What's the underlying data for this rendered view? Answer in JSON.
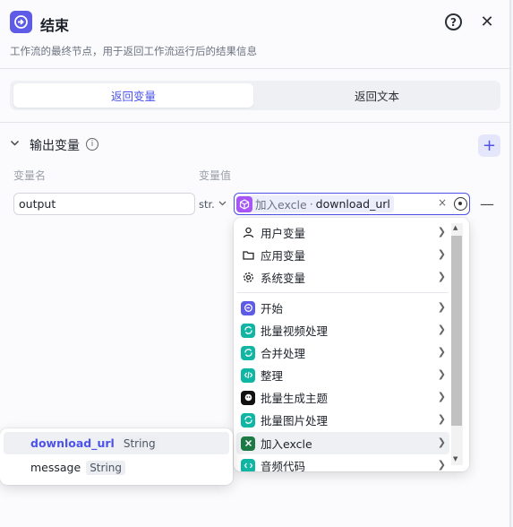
{
  "header": {
    "title": "结束",
    "help_icon": "help-circle-icon",
    "close_icon": "close-icon",
    "description": "工作流的最终节点，用于返回工作流运行后的结果信息"
  },
  "tabs": [
    {
      "label": "返回变量",
      "active": true
    },
    {
      "label": "返回文本",
      "active": false
    }
  ],
  "output_section": {
    "title": "输出变量",
    "col_name": "变量名",
    "col_value": "变量值",
    "rows": [
      {
        "name": "output",
        "type": "str.",
        "value_node": "加入excle",
        "value_sep": "·",
        "value_var": "download_url",
        "clear_glyph": "×",
        "remove_glyph": "—"
      }
    ]
  },
  "dropdown": {
    "groups": [
      {
        "label": "用户变量",
        "icon": "user-icon"
      },
      {
        "label": "应用变量",
        "icon": "folder-icon"
      },
      {
        "label": "系统变量",
        "icon": "gear-icon"
      }
    ],
    "nodes": [
      {
        "label": "开始",
        "icon": "start-icon",
        "color": "#5e5ce6"
      },
      {
        "label": "批量视频处理",
        "icon": "loop-icon",
        "color": "#10b5a3"
      },
      {
        "label": "合并处理",
        "icon": "loop-icon",
        "color": "#10b5a3"
      },
      {
        "label": "整理",
        "icon": "code-icon",
        "color": "#10b5a3"
      },
      {
        "label": "批量生成主题",
        "icon": "bot-icon",
        "color": "#111111"
      },
      {
        "label": "批量图片处理",
        "icon": "loop-icon",
        "color": "#10b5a3"
      },
      {
        "label": "加入excle",
        "icon": "excel-icon",
        "color": "#1d7a44",
        "hover": true
      },
      {
        "label": "音频代码",
        "icon": "code-icon",
        "color": "#10b5a3"
      }
    ]
  },
  "sub_popup": {
    "items": [
      {
        "name": "download_url",
        "type": "String",
        "active": true
      },
      {
        "name": "message",
        "type": "String",
        "active": false
      }
    ]
  },
  "colors": {
    "accent": "#4d53e8",
    "node_purple": "#5e5ce6",
    "teal": "#10b5a3",
    "excel_green": "#1d7a44"
  }
}
